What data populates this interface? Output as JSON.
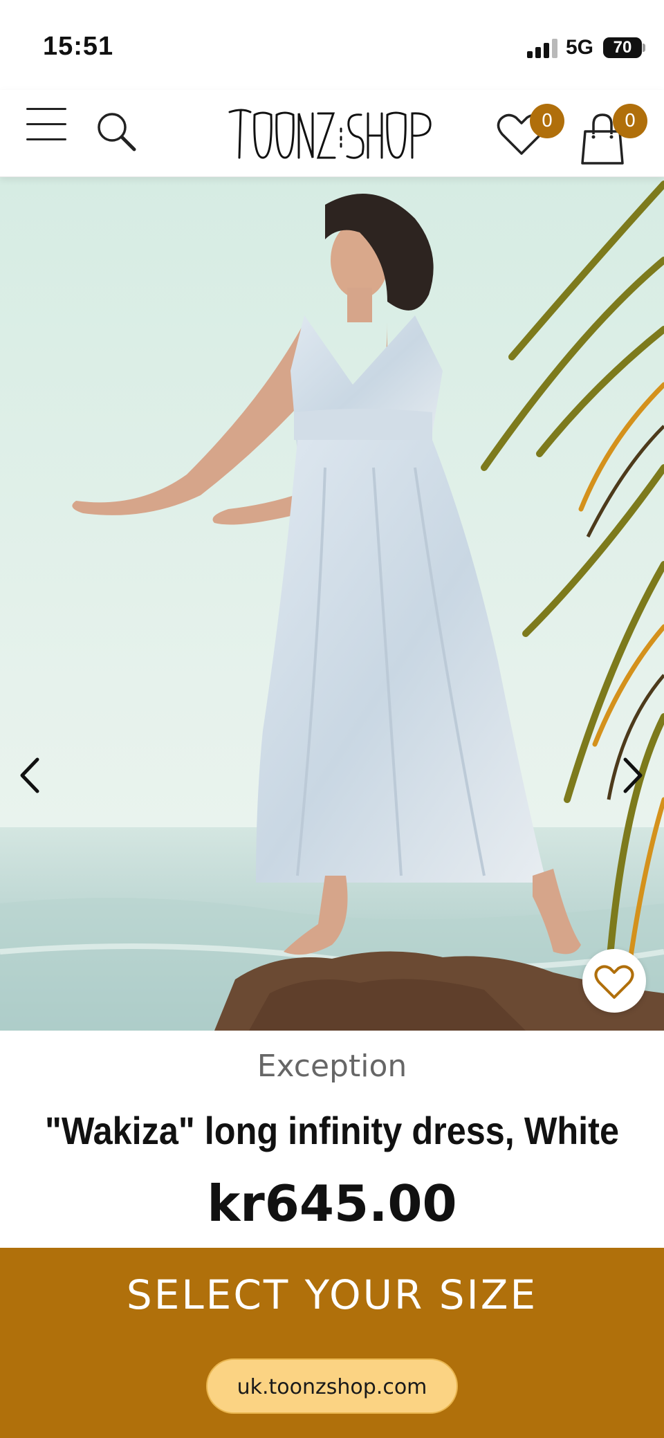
{
  "status_bar": {
    "time": "15:51",
    "network": "5G",
    "battery": "70"
  },
  "header": {
    "logo_text": "TOONZ:SHOP",
    "wishlist_count": "0",
    "cart_count": "0"
  },
  "product": {
    "brand": "Exception",
    "title": "\"Wakiza\" long infinity dress, White",
    "price": "kr645.00"
  },
  "actions": {
    "select_size_label": "SELECT YOUR SIZE"
  },
  "browser": {
    "url": "uk.toonzshop.com"
  },
  "colors": {
    "accent": "#b06f0b",
    "url_pill": "#fbd383"
  },
  "icons": [
    "menu-icon",
    "search-icon",
    "heart-icon",
    "shopping-bag-icon",
    "chevron-left-icon",
    "chevron-right-icon"
  ]
}
